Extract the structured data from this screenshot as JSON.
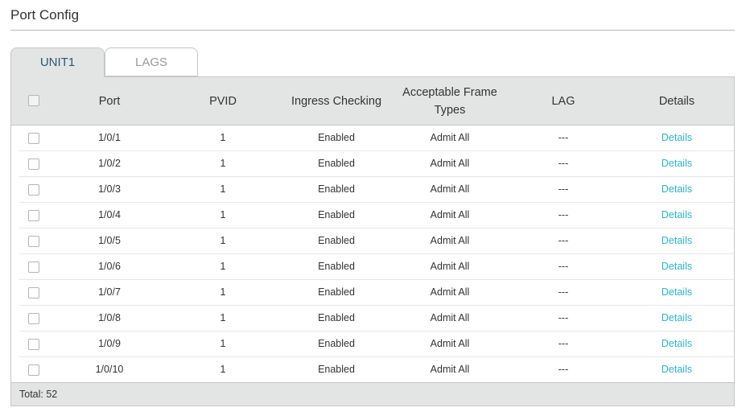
{
  "page": {
    "title": "Port Config"
  },
  "tabs": [
    {
      "label": "UNIT1",
      "active": true
    },
    {
      "label": "LAGS",
      "active": false
    }
  ],
  "table": {
    "headers": {
      "port": "Port",
      "pvid": "PVID",
      "ingress": "Ingress Checking",
      "frame_line1": "Acceptable Frame",
      "frame_line2": "Types",
      "lag": "LAG",
      "details": "Details"
    },
    "rows": [
      {
        "port": "1/0/1",
        "pvid": "1",
        "ingress": "Enabled",
        "frame": "Admit All",
        "lag": "---",
        "details": "Details"
      },
      {
        "port": "1/0/2",
        "pvid": "1",
        "ingress": "Enabled",
        "frame": "Admit All",
        "lag": "---",
        "details": "Details"
      },
      {
        "port": "1/0/3",
        "pvid": "1",
        "ingress": "Enabled",
        "frame": "Admit All",
        "lag": "---",
        "details": "Details"
      },
      {
        "port": "1/0/4",
        "pvid": "1",
        "ingress": "Enabled",
        "frame": "Admit All",
        "lag": "---",
        "details": "Details"
      },
      {
        "port": "1/0/5",
        "pvid": "1",
        "ingress": "Enabled",
        "frame": "Admit All",
        "lag": "---",
        "details": "Details"
      },
      {
        "port": "1/0/6",
        "pvid": "1",
        "ingress": "Enabled",
        "frame": "Admit All",
        "lag": "---",
        "details": "Details"
      },
      {
        "port": "1/0/7",
        "pvid": "1",
        "ingress": "Enabled",
        "frame": "Admit All",
        "lag": "---",
        "details": "Details"
      },
      {
        "port": "1/0/8",
        "pvid": "1",
        "ingress": "Enabled",
        "frame": "Admit All",
        "lag": "---",
        "details": "Details"
      },
      {
        "port": "1/0/9",
        "pvid": "1",
        "ingress": "Enabled",
        "frame": "Admit All",
        "lag": "---",
        "details": "Details"
      },
      {
        "port": "1/0/10",
        "pvid": "1",
        "ingress": "Enabled",
        "frame": "Admit All",
        "lag": "---",
        "details": "Details"
      }
    ],
    "total_label": "Total: 52"
  },
  "colors": {
    "header_bg": "#e3e5e5",
    "link": "#2bb5cf",
    "active_tab_text": "#2a5a6f"
  }
}
